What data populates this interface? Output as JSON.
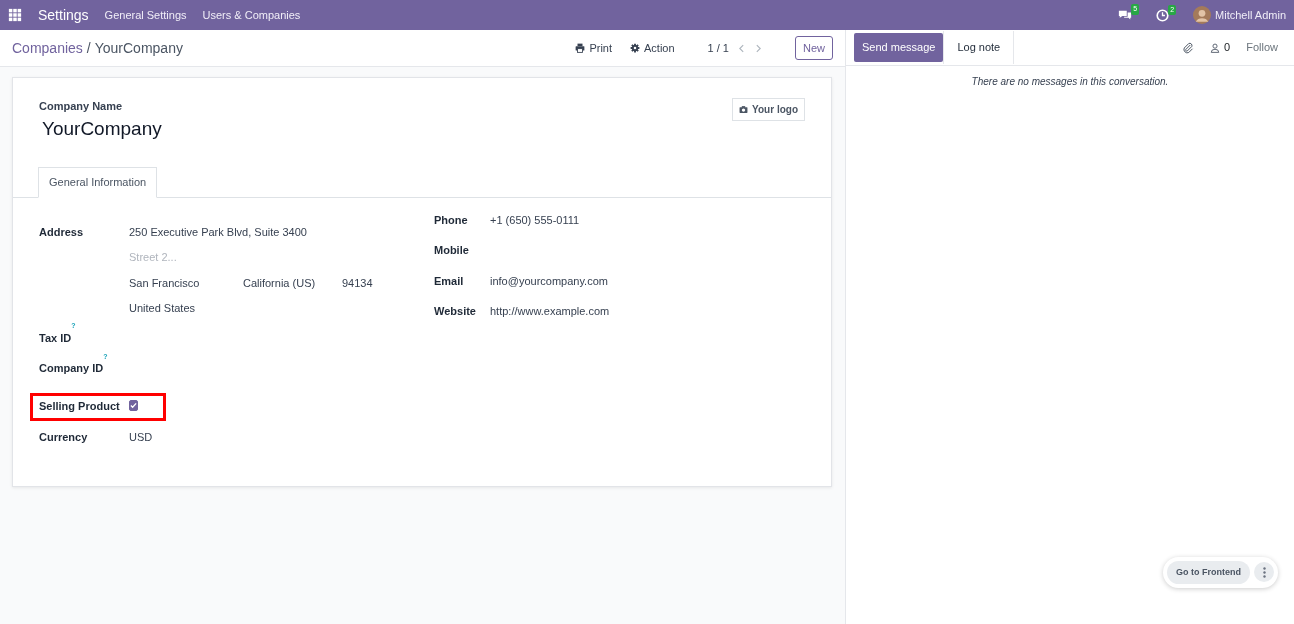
{
  "navbar": {
    "app": "Settings",
    "menus": [
      "General Settings",
      "Users & Companies"
    ],
    "messages_count": "5",
    "activities_count": "2",
    "user": "Mitchell Admin"
  },
  "breadcrumb": {
    "parent": "Companies",
    "separator": "/",
    "current": "YourCompany"
  },
  "actions": [
    {
      "kind": "print",
      "label": "Print"
    },
    {
      "kind": "gear",
      "label": "Action"
    }
  ],
  "pager": {
    "value": "1 / 1"
  },
  "new_button": "New",
  "form": {
    "name_label": "Company Name",
    "name": "YourCompany",
    "logo_button": "Your logo",
    "tabs": [
      {
        "label": "General Information",
        "selected": true
      }
    ],
    "left_fields": [
      {
        "kind": "address",
        "label": "Address",
        "street": "250 Executive Park Blvd, Suite 3400",
        "street2_placeholder": "Street 2...",
        "city": "San Francisco",
        "state": "California (US)",
        "zip": "94134",
        "country": "United States"
      },
      {
        "kind": "text",
        "label": "Tax ID",
        "help": "?"
      },
      {
        "kind": "text",
        "label": "Company ID",
        "help": "?"
      },
      {
        "kind": "checkbox",
        "label": "Selling Product",
        "checked": true,
        "highlighted": true
      },
      {
        "kind": "text",
        "label": "Currency",
        "value": "USD"
      }
    ],
    "right_fields": [
      {
        "kind": "text",
        "label": "Phone",
        "value": "+1 (650) 555-0111"
      },
      {
        "kind": "text",
        "label": "Mobile"
      },
      {
        "kind": "text",
        "label": "Email",
        "value": "info@yourcompany.com"
      },
      {
        "kind": "text",
        "label": "Website",
        "value": "http://www.example.com"
      }
    ]
  },
  "chatter": {
    "buttons": [
      {
        "label": "Send message",
        "kind": "primary"
      },
      {
        "label": "Log note",
        "kind": "tab"
      }
    ],
    "followers_count": "0",
    "follow": "Follow",
    "empty_text": "There are no messages in this conversation."
  },
  "floating": {
    "button": "Go to Frontend"
  }
}
